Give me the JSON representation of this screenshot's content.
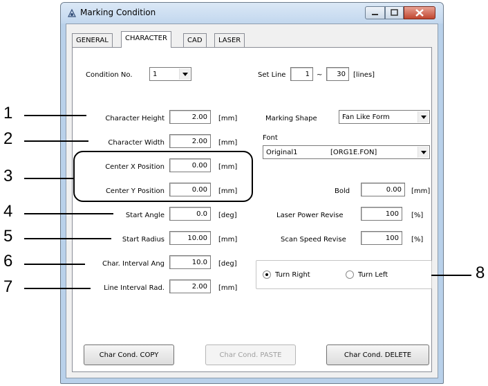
{
  "window": {
    "title": "Marking Condition"
  },
  "tabs": [
    "GENERAL",
    "CHARACTER",
    "CAD",
    "LASER"
  ],
  "condition": {
    "label": "Condition No.",
    "value": "1"
  },
  "set_line": {
    "label": "Set Line",
    "from": "1",
    "separator": "~",
    "to": "30",
    "unit": "[lines]"
  },
  "left_fields": [
    {
      "label": "Character Height",
      "value": "2.00",
      "unit": "[mm]"
    },
    {
      "label": "Character Width",
      "value": "2.00",
      "unit": "[mm]"
    },
    {
      "label": "Center X Position",
      "value": "0.00",
      "unit": "[mm]"
    },
    {
      "label": "Center Y Position",
      "value": "0.00",
      "unit": "[mm]"
    },
    {
      "label": "Start Angle",
      "value": "0.0",
      "unit": "[deg]"
    },
    {
      "label": "Start Radius",
      "value": "10.00",
      "unit": "[mm]"
    },
    {
      "label": "Char. Interval Ang",
      "value": "10.0",
      "unit": "[deg]"
    },
    {
      "label": "Line Interval Rad.",
      "value": "2.00",
      "unit": "[mm]"
    }
  ],
  "marking_shape": {
    "label": "Marking Shape",
    "value": "Fan Like Form"
  },
  "font": {
    "label": "Font",
    "name": "Original1",
    "file": "[ORG1E.FON]"
  },
  "bold": {
    "label": "Bold",
    "value": "0.00",
    "unit": "[mm]"
  },
  "laser_power": {
    "label": "Laser Power Revise",
    "value": "100",
    "unit": "[%]"
  },
  "scan_speed": {
    "label": "Scan Speed Revise",
    "value": "100",
    "unit": "[%]"
  },
  "direction": {
    "turn_right": "Turn Right",
    "turn_left": "Turn Left",
    "selected": "Turn Right"
  },
  "buttons": {
    "copy": "Char Cond. COPY",
    "paste": "Char Cond. PASTE",
    "delete": "Char Cond. DELETE"
  },
  "callouts": [
    "1",
    "2",
    "3",
    "4",
    "5",
    "6",
    "7",
    "8"
  ]
}
